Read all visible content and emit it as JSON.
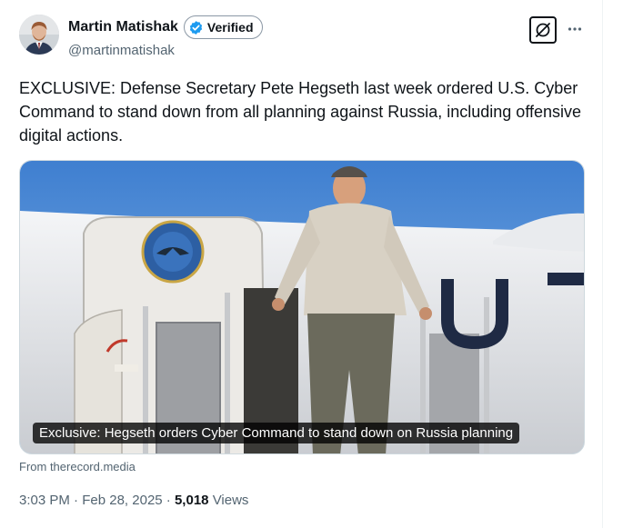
{
  "author": {
    "display_name": "Martin Matishak",
    "verified_label": "Verified",
    "handle": "@martinmatishak"
  },
  "tweet": {
    "text": "EXCLUSIVE: Defense Secretary Pete Hegseth last week ordered U.S. Cyber Command to stand down from all planning against Russia, including offensive digital actions."
  },
  "media": {
    "caption": "Exclusive: Hegseth orders Cyber Command to stand down on Russia planning",
    "source": "From therecord.media"
  },
  "meta": {
    "time": "3:03 PM",
    "date": "Feb 28, 2025",
    "separator": "·",
    "views_count": "5,018",
    "views_label": "Views"
  },
  "icons": {
    "verified": "verified-badge-icon",
    "logo": "slashed-circle-logo-icon",
    "more": "more-options-icon"
  },
  "colors": {
    "verified_blue": "#1d9bf0",
    "secondary_text": "#536471",
    "primary_text": "#0f1419"
  }
}
